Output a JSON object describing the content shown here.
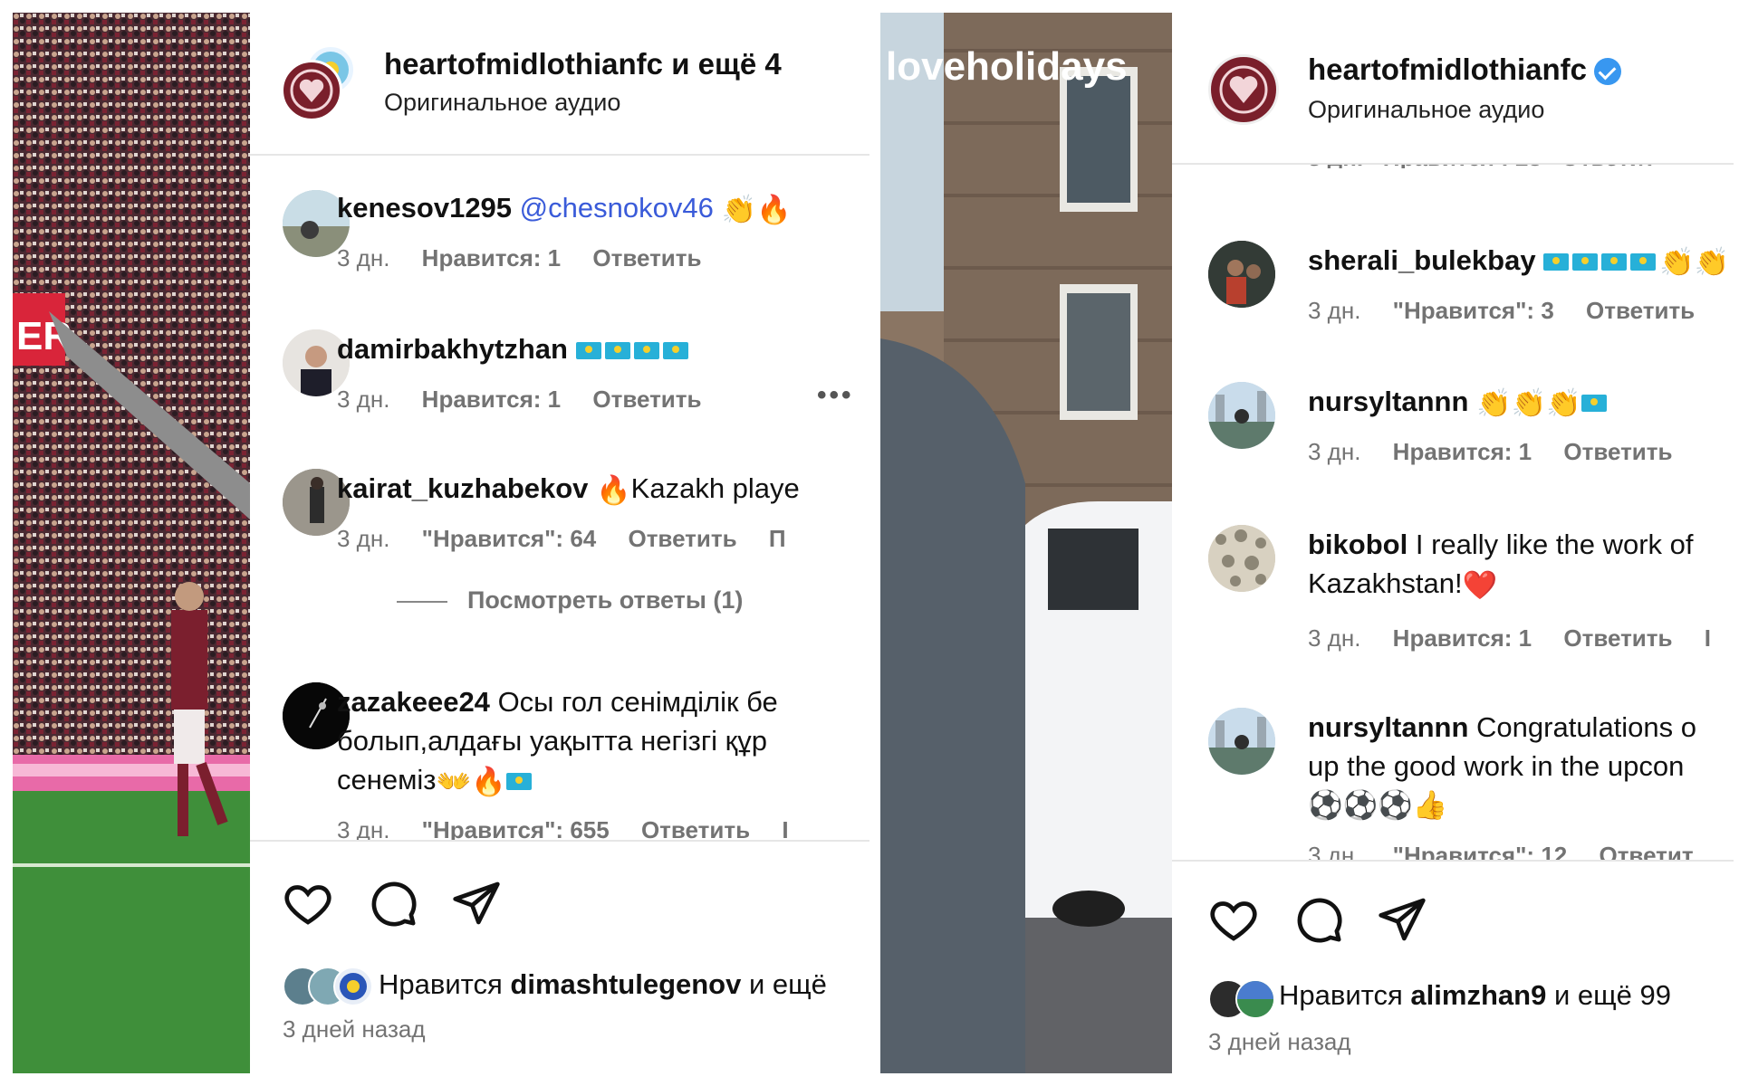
{
  "left_post": {
    "header": {
      "title": "heartofmidlothianfc",
      "title_suffix": "и ещё 4",
      "subtitle": "Оригинальное аудио"
    },
    "photo_banner_text": "ER",
    "comments": [
      {
        "user": "kenesov1295",
        "mention": "@chesnokov46",
        "text": "",
        "emoji": "👏🔥",
        "time": "3 дн.",
        "likes": "Нравится: 1",
        "reply": "Ответить"
      },
      {
        "user": "damirbakhytzhan",
        "mention": "",
        "text": "",
        "emoji": "",
        "flags": 4,
        "time": "3 дн.",
        "likes": "Нравится: 1",
        "reply": "Ответить",
        "more": "•••"
      },
      {
        "user": "kairat_kuzhabekov",
        "mention": "",
        "text": "Kazakh playe",
        "emoji": "🔥",
        "time": "3 дн.",
        "likes": "\"Нравится\": 64",
        "reply": "Ответить",
        "extra": "П"
      },
      {
        "user": "zazakeee24",
        "mention": "",
        "line1": "Осы гол сенімділік бе",
        "line2": "болып,алдағы уақытта негізгі құр",
        "line3": "сенеміз",
        "line3_emoji": "👐🔥",
        "time": "3 дн.",
        "likes": "\"Нравится\": 655",
        "reply": "Ответить",
        "extra": "І"
      }
    ],
    "view_replies": "Посмотреть ответы (1)",
    "liked_by_prefix": "Нравится",
    "liked_by_user": "dimashtulegenov",
    "liked_by_suffix": "и ещё",
    "posted_ago": "3 дней назад"
  },
  "right_post": {
    "header": {
      "title": "heartofmidlothianfc",
      "subtitle": "Оригинальное аудио"
    },
    "photo_brand": "loveholidays",
    "cut_meta": "3 дн.   Нравится : 28   Ответит",
    "comments": [
      {
        "user": "sherali_bulekbay",
        "text": "",
        "emoji": "👏👏",
        "flags": 4,
        "time": "3 дн.",
        "likes": "\"Нравится\": 3",
        "reply": "Ответить"
      },
      {
        "user": "nursyltannn",
        "text": "",
        "emoji": "👏👏👏",
        "flags": 1,
        "time": "3 дн.",
        "likes": "Нравится: 1",
        "reply": "Ответить"
      },
      {
        "user": "bikobol",
        "line1": "I really like the work of",
        "line2": "Kazakhstan!",
        "line2_emoji": "❤️",
        "time": "3 дн.",
        "likes": "Нравится: 1",
        "reply": "Ответить",
        "extra": "І"
      },
      {
        "user": "nursyltannn",
        "line1": "Congratulations o",
        "line2": "up the good work in the upcon",
        "line3_emoji": "⚽⚽⚽👍",
        "time": "3 дн.",
        "likes": "\"Нравится\": 12",
        "reply": "Ответит"
      }
    ],
    "liked_by_prefix": "Нравится",
    "liked_by_user": "alimzhan9",
    "liked_by_suffix": "и ещё 99",
    "posted_ago": "3 дней назад"
  },
  "colors": {
    "hearts_maroon": "#7a1f2b",
    "mention_blue": "#3a5bd9",
    "meta_gray": "#737373",
    "verified_blue": "#3897f0"
  }
}
